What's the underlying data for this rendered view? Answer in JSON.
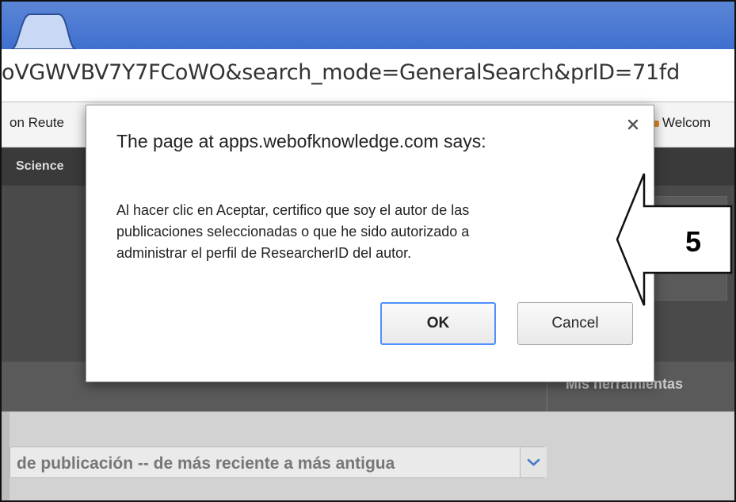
{
  "browser": {
    "url": "oVGWVBV7Y7FCoWO&search_mode=GeneralSearch&prID=71fd",
    "bookmarks": {
      "left": "on Reute",
      "right": "Welcom"
    }
  },
  "page": {
    "nav_label": "Science",
    "tools_label": "Mis herramientas",
    "sort_select_value": "de publicación -- de más reciente a más antigua"
  },
  "dialog": {
    "title": "The page at apps.webofknowledge.com says:",
    "message_lines": [
      "Al hacer clic en Aceptar, certifico que soy el autor de las",
      "publicaciones seleccionadas o que he sido autorizado a",
      "administrar el perfil de ResearcherID del autor."
    ],
    "ok_label": "OK",
    "cancel_label": "Cancel"
  },
  "callout": {
    "number": "5"
  },
  "colors": {
    "tabbar": "#4a79d4",
    "ok_focus": "#4d90fe",
    "page_dark": "#3a3a3a"
  }
}
